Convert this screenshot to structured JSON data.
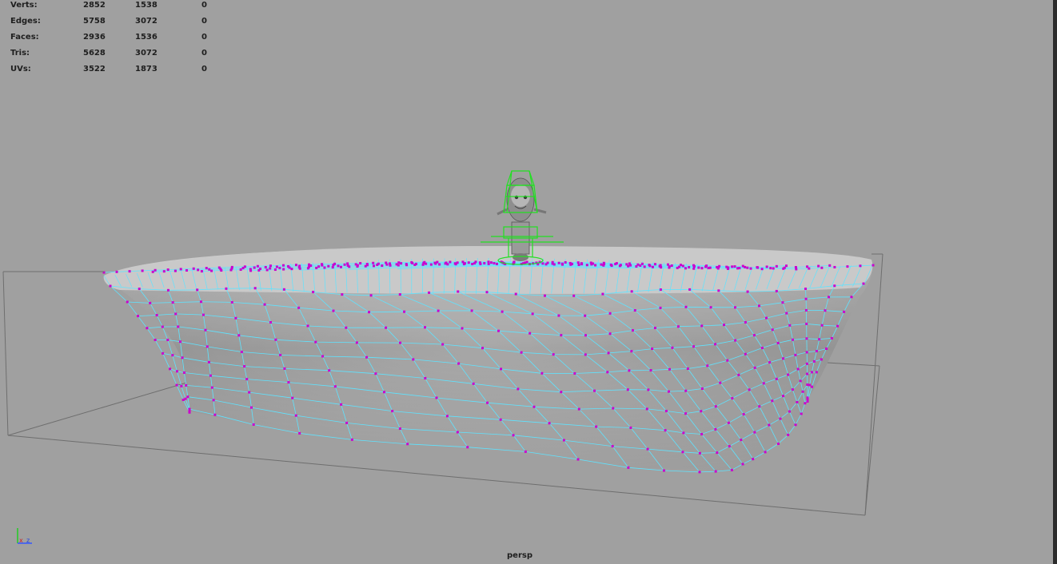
{
  "hud": {
    "rows": [
      {
        "label": "Verts:",
        "c1": "2852",
        "c2": "1538",
        "c3": "0"
      },
      {
        "label": "Edges:",
        "c1": "5758",
        "c2": "3072",
        "c3": "0"
      },
      {
        "label": "Faces:",
        "c1": "2936",
        "c2": "1536",
        "c3": "0"
      },
      {
        "label": "Tris:",
        "c1": "5628",
        "c2": "3072",
        "c3": "0"
      },
      {
        "label": "UVs:",
        "c1": "3522",
        "c2": "1873",
        "c3": "0"
      }
    ]
  },
  "viewport": {
    "camera": "persp",
    "background": "#a0a0a0",
    "wire_color": "#5fe3ff",
    "vertex_color": "#cc00cc",
    "rig_color": "#22e022",
    "bbox_color": "#6e6e6e"
  },
  "axis": {
    "x": "x",
    "z": "z"
  }
}
